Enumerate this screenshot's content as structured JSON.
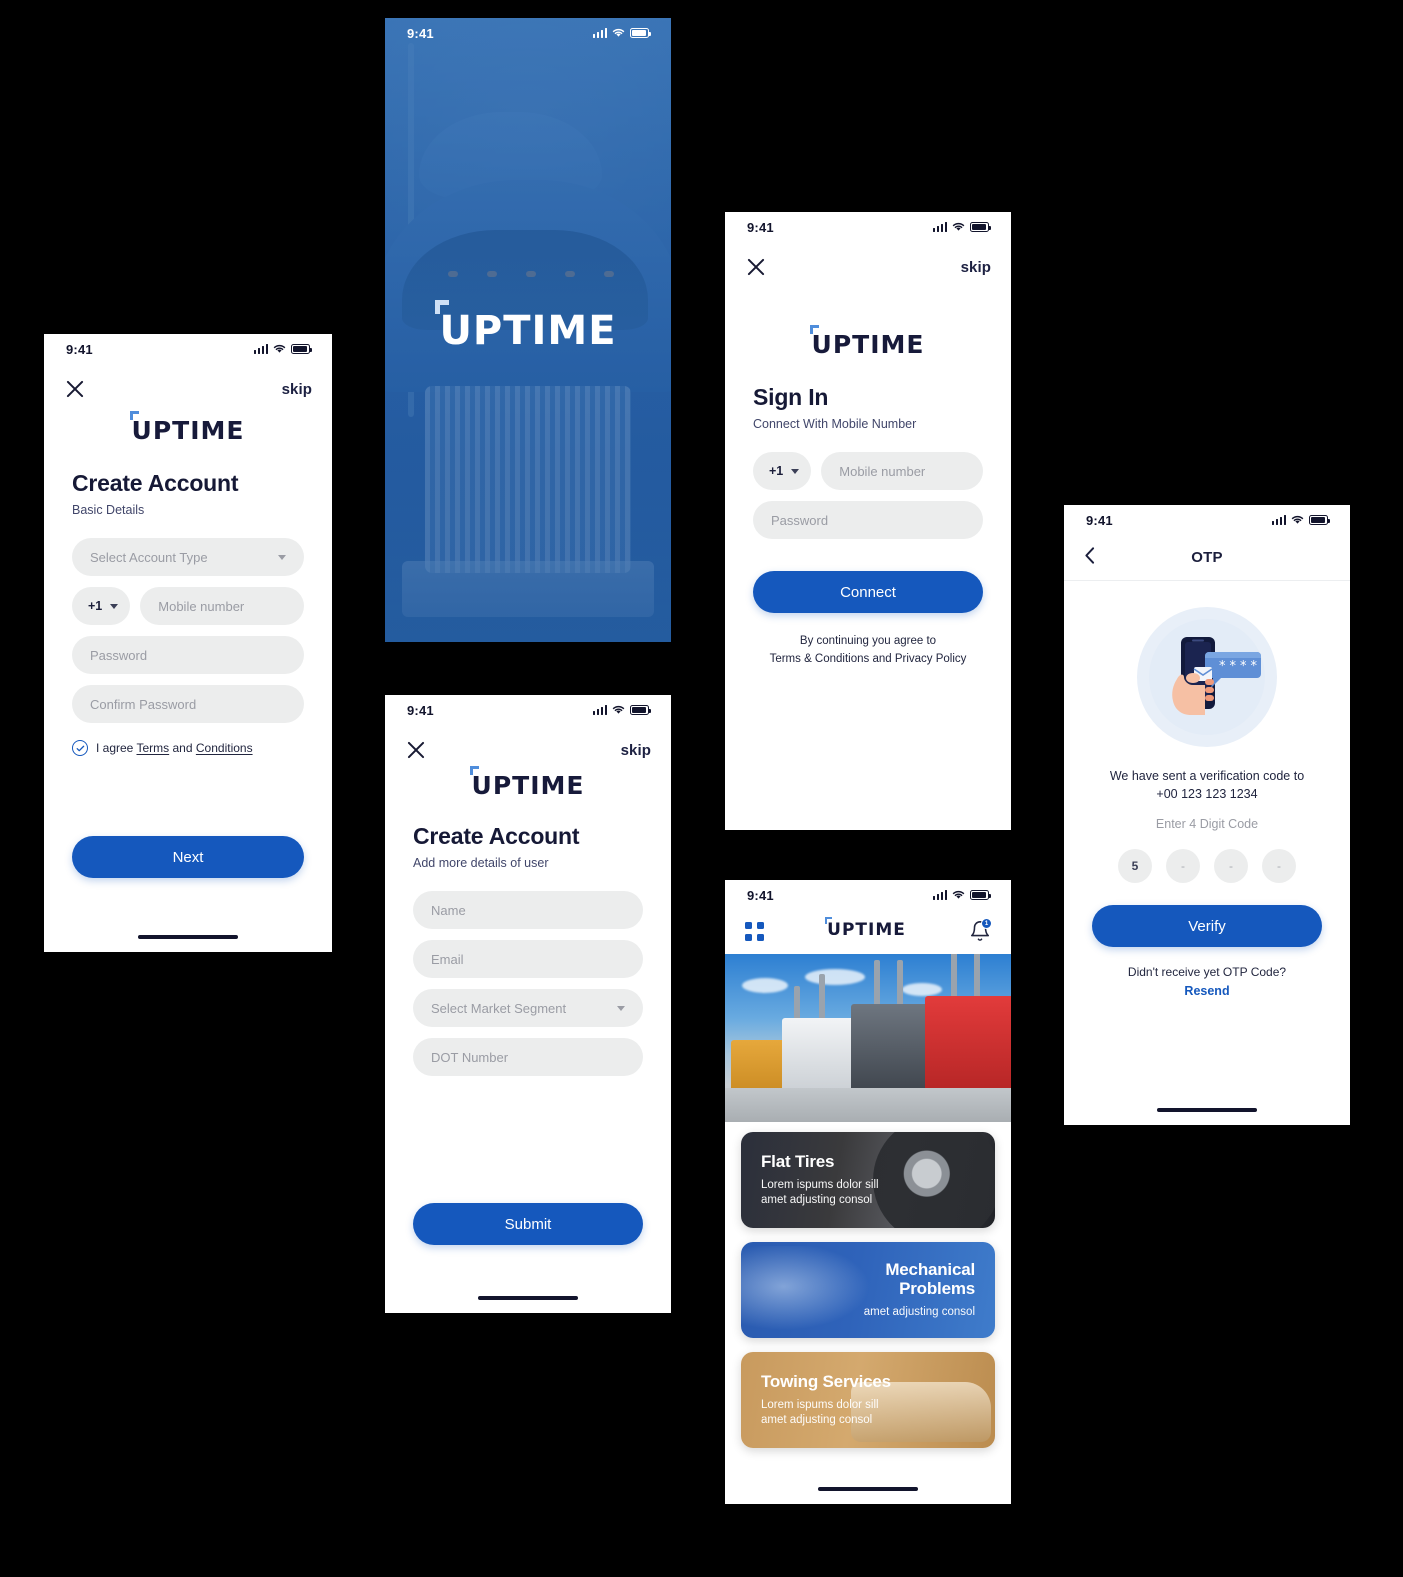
{
  "brand": {
    "logo_text": "UPTIME",
    "accent": "#1558bd",
    "logo_tick_color": "#4f8ddb",
    "dark": "#171a3a"
  },
  "status_bar": {
    "time": "9:41"
  },
  "screens": {
    "create_account_basic": {
      "skip": "skip",
      "title": "Create Account",
      "subtitle": "Basic Details",
      "fields": {
        "account_type": "Select Account Type",
        "country_code": "+1",
        "mobile": "Mobile number",
        "password": "Password",
        "confirm_password": "Confirm Password"
      },
      "agree_prefix": "I agree",
      "agree_terms": "Terms",
      "agree_and": "and",
      "agree_conditions": "Conditions",
      "primary_button": "Next"
    },
    "splash": {
      "logo_text": "UPTIME"
    },
    "create_account_details": {
      "skip": "skip",
      "title": "Create Account",
      "subtitle": "Add more details of user",
      "fields": {
        "name": "Name",
        "email": "Email",
        "market_segment": "Select Market Segment",
        "dot_number": "DOT Number"
      },
      "primary_button": "Submit"
    },
    "sign_in": {
      "skip": "skip",
      "title": "Sign In",
      "subtitle": "Connect With Mobile Number",
      "fields": {
        "country_code": "+1",
        "mobile": "Mobile number",
        "password": "Password"
      },
      "primary_button": "Connect",
      "legal_line1": "By continuing you agree to",
      "legal_line2": "Terms & Conditions and Privacy Policy"
    },
    "home": {
      "notification_badge": "1",
      "cards": [
        {
          "title": "Flat Tires",
          "desc_line1": "Lorem ispums dolor sill",
          "desc_line2": "amet adjusting consol",
          "theme": "tires"
        },
        {
          "title_line1": "Mechanical",
          "title_line2": "Problems",
          "desc_line1": "amet adjusting consol",
          "theme": "mech"
        },
        {
          "title": "Towing Services",
          "desc_line1": "Lorem ispums dolor sill",
          "desc_line2": "amet adjusting consol",
          "theme": "tow"
        }
      ]
    },
    "otp": {
      "title": "OTP",
      "sent_text": "We have sent a verification code to",
      "phone": "+00 123 123 1234",
      "hint": "Enter 4 Digit Code",
      "digits": [
        "5",
        "-",
        "-",
        "-"
      ],
      "primary_button": "Verify",
      "footer": "Didn't receive yet OTP Code?",
      "resend": "Resend"
    }
  }
}
